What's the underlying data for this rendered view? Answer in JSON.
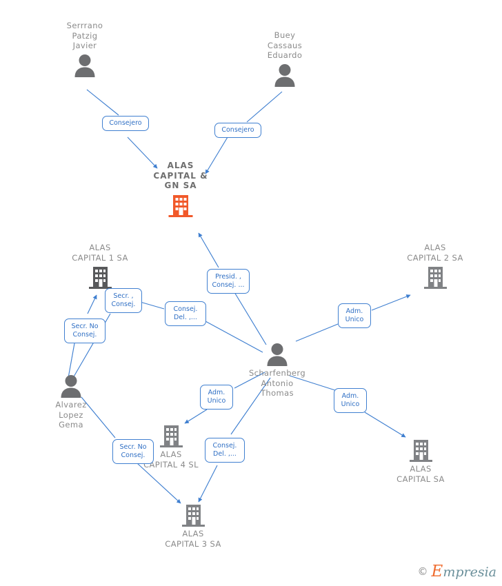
{
  "diagram": {
    "title": "ALAS CAPITAL & GN SA corporate relationship chart",
    "colors": {
      "main_company": "#f1592a",
      "company_icon": "#58595b",
      "company_icon_light": "#808285",
      "person_icon": "#6d6e70",
      "edge": "#3f7fd0",
      "tag_border": "#3f7fd0",
      "tag_text": "#2f6fc4",
      "node_label": "#8a8a8a"
    },
    "nodes": [
      {
        "id": "serrrano",
        "type": "person",
        "label": "Serrrano\nPatzig\nJavier"
      },
      {
        "id": "buey",
        "type": "person",
        "label": "Buey\nCassaus\nEduardo"
      },
      {
        "id": "main",
        "type": "company-main",
        "label": "ALAS\nCAPITAL &\nGN SA"
      },
      {
        "id": "alas1",
        "type": "company",
        "label": "ALAS\nCAPITAL 1 SA"
      },
      {
        "id": "alas2",
        "type": "company",
        "label": "ALAS\nCAPITAL 2 SA"
      },
      {
        "id": "scharfen",
        "type": "person",
        "label": "Scharfenberg\nAntonio\nThomas"
      },
      {
        "id": "alvarez",
        "type": "person",
        "label": "Alvarez\nLopez\nGema"
      },
      {
        "id": "alas4",
        "type": "company",
        "label": "ALAS\nCAPITAL 4  SL"
      },
      {
        "id": "alas3",
        "type": "company",
        "label": "ALAS\nCAPITAL 3 SA"
      },
      {
        "id": "alasplain",
        "type": "company",
        "label": "ALAS\nCAPITAL SA"
      }
    ],
    "relations": [
      {
        "id": "r1",
        "label": "Consejero",
        "from": "serrrano",
        "to": "main"
      },
      {
        "id": "r2",
        "label": "Consejero",
        "from": "buey",
        "to": "main"
      },
      {
        "id": "r3",
        "label": "Secr. ,\nConsej.",
        "from": "alvarez",
        "to": "alas1"
      },
      {
        "id": "r4",
        "label": "Secr.  No\nConsej.",
        "from": "alvarez",
        "to": "alas1"
      },
      {
        "id": "r5",
        "label": "Consej.\nDel. ,...",
        "from": "scharfen",
        "to": "alas1"
      },
      {
        "id": "r6",
        "label": "Presid. ,\nConsej. ...",
        "from": "scharfen",
        "to": "main"
      },
      {
        "id": "r7",
        "label": "Adm.\nUnico",
        "from": "scharfen",
        "to": "alas2"
      },
      {
        "id": "r8",
        "label": "Adm.\nUnico",
        "from": "scharfen",
        "to": "alas4"
      },
      {
        "id": "r9",
        "label": "Adm.\nUnico",
        "from": "scharfen",
        "to": "alasplain"
      },
      {
        "id": "r10",
        "label": "Secr.  No\nConsej.",
        "from": "alvarez",
        "to": "alas3"
      },
      {
        "id": "r11",
        "label": "Consej.\nDel. ,...",
        "from": "scharfen",
        "to": "alas3"
      }
    ],
    "watermark": {
      "copyright": "©",
      "brand_initial": "E",
      "brand_rest": "mpresia"
    }
  }
}
